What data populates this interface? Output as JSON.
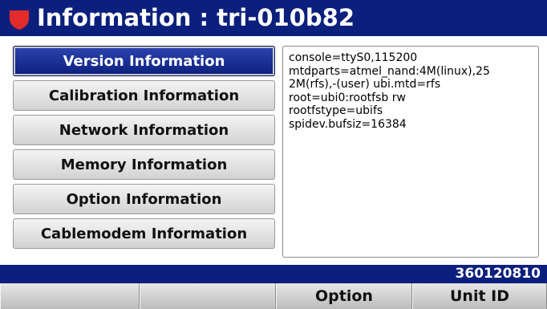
{
  "header": {
    "title": "Information : tri-010b82",
    "logo_icon": "shield-icon",
    "colors": {
      "bar": "#0b1f7c",
      "logo": "#e32b2b"
    }
  },
  "menu": {
    "items": [
      {
        "label": "Version Information",
        "selected": true
      },
      {
        "label": "Calibration Information",
        "selected": false
      },
      {
        "label": "Network Information",
        "selected": false
      },
      {
        "label": "Memory Information",
        "selected": false
      },
      {
        "label": "Option Information",
        "selected": false
      },
      {
        "label": "Cablemodem Information",
        "selected": false
      }
    ]
  },
  "details": {
    "lines": [
      "console=ttyS0,115200",
      "mtdparts=atmel_nand:4M(linux),25",
      "2M(rfs),-(user) ubi.mtd=rfs",
      "root=ubi0:rootfsb rw",
      "rootfstype=ubifs",
      "spidev.bufsiz=16384"
    ]
  },
  "status": {
    "serial": "360120810"
  },
  "softkeys": [
    "",
    "",
    "Option",
    "Unit ID"
  ]
}
